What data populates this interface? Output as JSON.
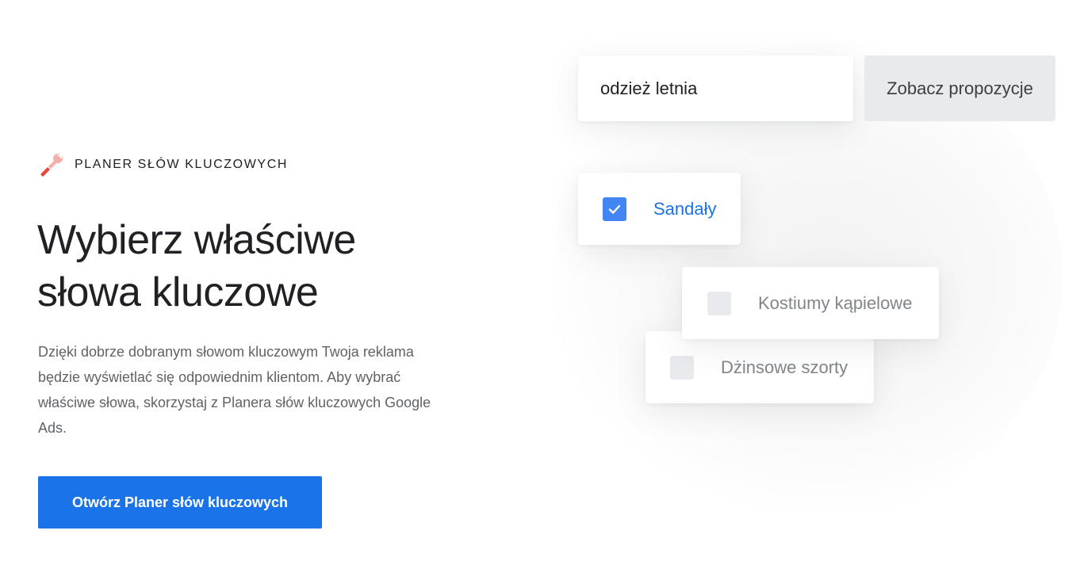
{
  "eyebrow": {
    "icon": "wrench-icon",
    "label": "PLANER SŁÓW KLUCZOWYCH"
  },
  "headline": {
    "line1": "Wybierz właściwe",
    "line2": "słowa kluczowe"
  },
  "body": "Dzięki dobrze dobranym słowom kluczowym Twoja reklama będzie wyświetlać się odpowiednim klientom. Aby wybrać właściwe słowa, skorzystaj z Planera słów kluczowych Google Ads.",
  "cta": {
    "label": "Otwórz Planer słów kluczowych"
  },
  "search": {
    "value": "odzież letnia",
    "button_label": "Zobacz propozycje"
  },
  "keywords": [
    {
      "label": "Sandały",
      "checked": true
    },
    {
      "label": "Kostiumy kąpielowe",
      "checked": false
    },
    {
      "label": "Dżinsowe szorty",
      "checked": false
    }
  ],
  "colors": {
    "primary": "#1a73e8",
    "checkbox_checked": "#4285f4",
    "checkbox_unchecked": "#e8eaed",
    "icon_red": "#ea4335",
    "icon_pink": "#f6aea9"
  }
}
